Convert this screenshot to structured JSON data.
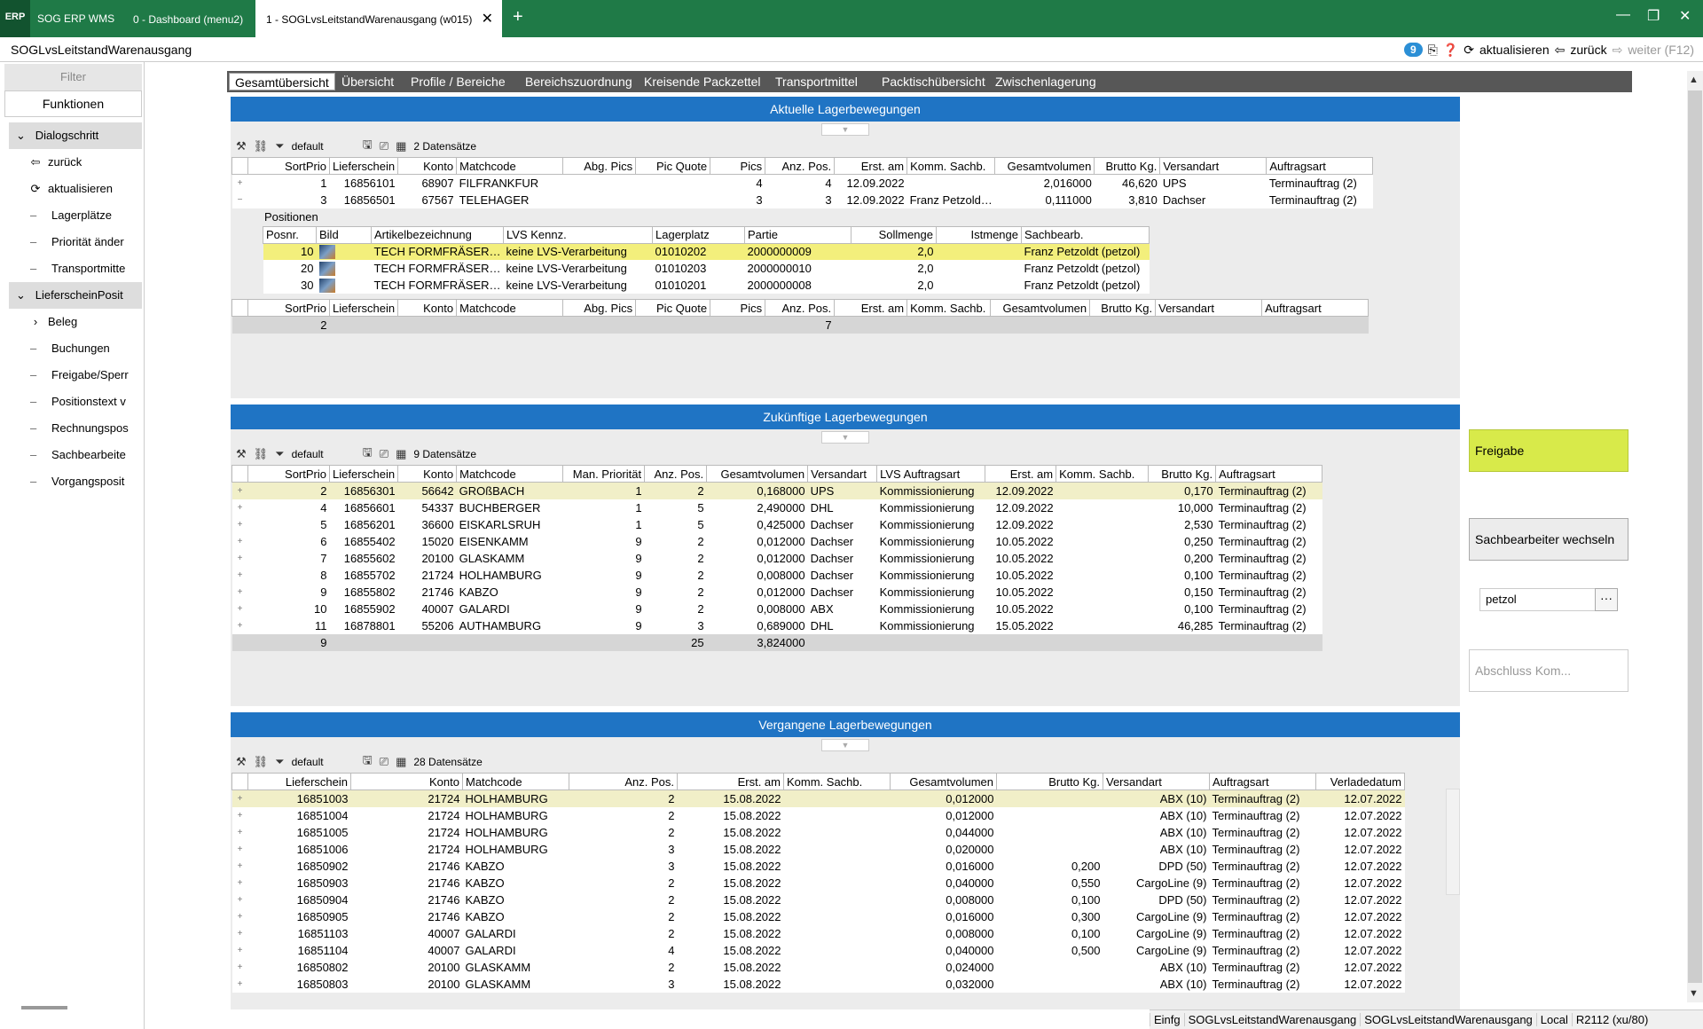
{
  "titlebar": {
    "logo": "ERP",
    "app_name": "SOG ERP WMS",
    "tabs": [
      {
        "label": "0 - Dashboard (menu2)"
      },
      {
        "label": "1 - SOGLvsLeitstandWarenausgang (w015)"
      }
    ],
    "close_tab": "✕",
    "add_tab": "+",
    "min": "—",
    "restore": "❐",
    "close": "✕"
  },
  "header": {
    "page_title": "SOGLvsLeitstandWarenausgang",
    "badge": "9",
    "refresh": "aktualisieren",
    "back": "zurück",
    "forward": "weiter (F12)"
  },
  "sidebar": {
    "filter": "Filter",
    "functions": "Funktionen",
    "groups": [
      {
        "label": "Dialogschritt",
        "items": [
          {
            "label": "zurück",
            "icon": "back-arrow-icon"
          },
          {
            "label": "aktualisieren",
            "icon": "refresh-icon"
          },
          {
            "label": "Lagerplätze"
          },
          {
            "label": "Priorität änder"
          },
          {
            "label": "Transportmitte"
          }
        ]
      },
      {
        "label": "LieferscheinPosit",
        "items": [
          {
            "label": "Beleg",
            "icon": "chevron-right-icon"
          },
          {
            "label": "Buchungen"
          },
          {
            "label": "Freigabe/Sperr"
          },
          {
            "label": "Positionstext v"
          },
          {
            "label": "Rechnungspos"
          },
          {
            "label": "Sachbearbeite"
          },
          {
            "label": "Vorgangsposit"
          }
        ]
      }
    ]
  },
  "tabs": [
    "Gesamtübersicht",
    "Übersicht",
    "Profile / Bereiche",
    "Bereichszuordnung",
    "Kreisende Packzettel",
    "Transportmittel",
    "Packtischübersicht",
    "Zwischenlagerung"
  ],
  "panels": {
    "current": {
      "title": "Aktuelle Lagerbewegungen",
      "layout": "default",
      "count": "2 Datensätze",
      "columns": [
        "SortPrio",
        "Lieferschein",
        "Konto",
        "Matchcode",
        "Abg. Pics",
        "Pic Quote",
        "Pics",
        "Anz. Pos.",
        "Erst. am",
        "Komm. Sachb.",
        "Gesamtvolumen",
        "Brutto Kg.",
        "Versandart",
        "Auftragsart"
      ],
      "rows": [
        {
          "exp": "+",
          "cells": [
            "1",
            "16856101",
            "68907",
            "FILFRANKFUR",
            "",
            "",
            "4",
            "4",
            "12.09.2022",
            "",
            "2,016000",
            "46,620",
            "UPS",
            "Terminauftrag (2)"
          ]
        },
        {
          "exp": "−",
          "cells": [
            "3",
            "16856501",
            "67567",
            "TELEHAGER",
            "",
            "",
            "3",
            "3",
            "12.09.2022",
            "Franz Petzold…",
            "0,111000",
            "3,810",
            "Dachser",
            "Terminauftrag (2)"
          ]
        }
      ],
      "positions": {
        "title": "Positionen",
        "columns": [
          "Posnr.",
          "Bild",
          "Artikelbezeichnung",
          "LVS Kennz.",
          "Lagerplatz",
          "Partie",
          "Sollmenge",
          "Istmenge",
          "Sachbearb."
        ],
        "rows": [
          [
            "10",
            "",
            "TECH FORMFRÄSER…",
            "keine LVS-Verarbeitung",
            "01010202",
            "2000000009",
            "2,0",
            "",
            "Franz Petzoldt (petzol)"
          ],
          [
            "20",
            "",
            "TECH FORMFRÄSER…",
            "keine LVS-Verarbeitung",
            "01010203",
            "2000000010",
            "2,0",
            "",
            "Franz Petzoldt (petzol)"
          ],
          [
            "30",
            "",
            "TECH FORMFRÄSER…",
            "keine LVS-Verarbeitung",
            "01010201",
            "2000000008",
            "2,0",
            "",
            "Franz Petzoldt (petzol)"
          ]
        ]
      },
      "footer": {
        "sortprio": "2",
        "anzpos": "7"
      }
    },
    "future": {
      "title": "Zukünftige Lagerbewegungen",
      "layout": "default",
      "count": "9 Datensätze",
      "columns": [
        "SortPrio",
        "Lieferschein",
        "Konto",
        "Matchcode",
        "Man. Priorität",
        "Anz. Pos.",
        "Gesamtvolumen",
        "Versandart",
        "LVS Auftragsart",
        "Erst. am",
        "Komm. Sachb.",
        "Brutto Kg.",
        "Auftragsart"
      ],
      "rows": [
        [
          "2",
          "16856301",
          "56642",
          "GROßBACH",
          "1",
          "2",
          "0,168000",
          "UPS",
          "Kommissionierung",
          "12.09.2022",
          "",
          "0,170",
          "Terminauftrag (2)"
        ],
        [
          "4",
          "16856601",
          "54337",
          "BUCHBERGER",
          "1",
          "5",
          "2,490000",
          "DHL",
          "Kommissionierung",
          "12.09.2022",
          "",
          "10,000",
          "Terminauftrag (2)"
        ],
        [
          "5",
          "16856201",
          "36600",
          "EISKARLSRUH",
          "1",
          "5",
          "0,425000",
          "Dachser",
          "Kommissionierung",
          "12.09.2022",
          "",
          "2,530",
          "Terminauftrag (2)"
        ],
        [
          "6",
          "16855402",
          "15020",
          "EISENKAMM",
          "9",
          "2",
          "0,012000",
          "Dachser",
          "Kommissionierung",
          "10.05.2022",
          "",
          "0,250",
          "Terminauftrag (2)"
        ],
        [
          "7",
          "16855602",
          "20100",
          "GLASKAMM",
          "9",
          "2",
          "0,012000",
          "Dachser",
          "Kommissionierung",
          "10.05.2022",
          "",
          "0,200",
          "Terminauftrag (2)"
        ],
        [
          "8",
          "16855702",
          "21724",
          "HOLHAMBURG",
          "9",
          "2",
          "0,008000",
          "Dachser",
          "Kommissionierung",
          "10.05.2022",
          "",
          "0,100",
          "Terminauftrag (2)"
        ],
        [
          "9",
          "16855802",
          "21746",
          "KABZO",
          "9",
          "2",
          "0,012000",
          "Dachser",
          "Kommissionierung",
          "10.05.2022",
          "",
          "0,150",
          "Terminauftrag (2)"
        ],
        [
          "10",
          "16855902",
          "40007",
          "GALARDI",
          "9",
          "2",
          "0,008000",
          "ABX",
          "Kommissionierung",
          "10.05.2022",
          "",
          "0,100",
          "Terminauftrag (2)"
        ],
        [
          "11",
          "16878801",
          "55206",
          "AUTHAMBURG",
          "9",
          "3",
          "0,689000",
          "DHL",
          "Kommissionierung",
          "15.05.2022",
          "",
          "46,285",
          "Terminauftrag (2)"
        ]
      ],
      "footer": {
        "sortprio": "9",
        "anzpos": "25",
        "volume": "3,824000"
      }
    },
    "past": {
      "title": "Vergangene Lagerbewegungen",
      "layout": "default",
      "count": "28 Datensätze",
      "columns": [
        "Lieferschein",
        "Konto",
        "Matchcode",
        "Anz. Pos.",
        "Erst. am",
        "Komm. Sachb.",
        "Gesamtvolumen",
        "Brutto Kg.",
        "Versandart",
        "Auftragsart",
        "Verladedatum"
      ],
      "rows": [
        [
          "16851003",
          "21724",
          "HOLHAMBURG",
          "2",
          "15.08.2022",
          "",
          "0,012000",
          "",
          "ABX (10)",
          "Terminauftrag (2)",
          "12.07.2022"
        ],
        [
          "16851004",
          "21724",
          "HOLHAMBURG",
          "2",
          "15.08.2022",
          "",
          "0,012000",
          "",
          "ABX (10)",
          "Terminauftrag (2)",
          "12.07.2022"
        ],
        [
          "16851005",
          "21724",
          "HOLHAMBURG",
          "2",
          "15.08.2022",
          "",
          "0,044000",
          "",
          "ABX (10)",
          "Terminauftrag (2)",
          "12.07.2022"
        ],
        [
          "16851006",
          "21724",
          "HOLHAMBURG",
          "3",
          "15.08.2022",
          "",
          "0,020000",
          "",
          "ABX (10)",
          "Terminauftrag (2)",
          "12.07.2022"
        ],
        [
          "16850902",
          "21746",
          "KABZO",
          "3",
          "15.08.2022",
          "",
          "0,016000",
          "0,200",
          "DPD (50)",
          "Terminauftrag (2)",
          "12.07.2022"
        ],
        [
          "16850903",
          "21746",
          "KABZO",
          "2",
          "15.08.2022",
          "",
          "0,040000",
          "0,550",
          "CargoLine (9)",
          "Terminauftrag (2)",
          "12.07.2022"
        ],
        [
          "16850904",
          "21746",
          "KABZO",
          "2",
          "15.08.2022",
          "",
          "0,008000",
          "0,100",
          "DPD (50)",
          "Terminauftrag (2)",
          "12.07.2022"
        ],
        [
          "16850905",
          "21746",
          "KABZO",
          "2",
          "15.08.2022",
          "",
          "0,016000",
          "0,300",
          "CargoLine (9)",
          "Terminauftrag (2)",
          "12.07.2022"
        ],
        [
          "16851103",
          "40007",
          "GALARDI",
          "2",
          "15.08.2022",
          "",
          "0,008000",
          "0,100",
          "CargoLine (9)",
          "Terminauftrag (2)",
          "12.07.2022"
        ],
        [
          "16851104",
          "40007",
          "GALARDI",
          "4",
          "15.08.2022",
          "",
          "0,040000",
          "0,500",
          "CargoLine (9)",
          "Terminauftrag (2)",
          "12.07.2022"
        ],
        [
          "16850802",
          "20100",
          "GLASKAMM",
          "2",
          "15.08.2022",
          "",
          "0,024000",
          "",
          "ABX (10)",
          "Terminauftrag (2)",
          "12.07.2022"
        ],
        [
          "16850803",
          "20100",
          "GLASKAMM",
          "3",
          "15.08.2022",
          "",
          "0,032000",
          "",
          "ABX (10)",
          "Terminauftrag (2)",
          "12.07.2022"
        ]
      ]
    }
  },
  "right_panel": {
    "release": "Freigabe",
    "change_clerk": "Sachbearbeiter wechseln",
    "clerk_value": "petzol",
    "combo_btn": "···",
    "close_comm": "Abschluss Kom..."
  },
  "status": [
    "Einfg",
    "SOGLvsLeitstandWarenausgang",
    "SOGLvsLeitstandWarenausgang",
    "Local",
    "R2112 (xu/80)"
  ],
  "colors": {
    "titlebar": "#1f7a47",
    "panel_header": "#1f74c4",
    "release_button": "#d8ea4a",
    "selected_row": "#f1efc8"
  }
}
